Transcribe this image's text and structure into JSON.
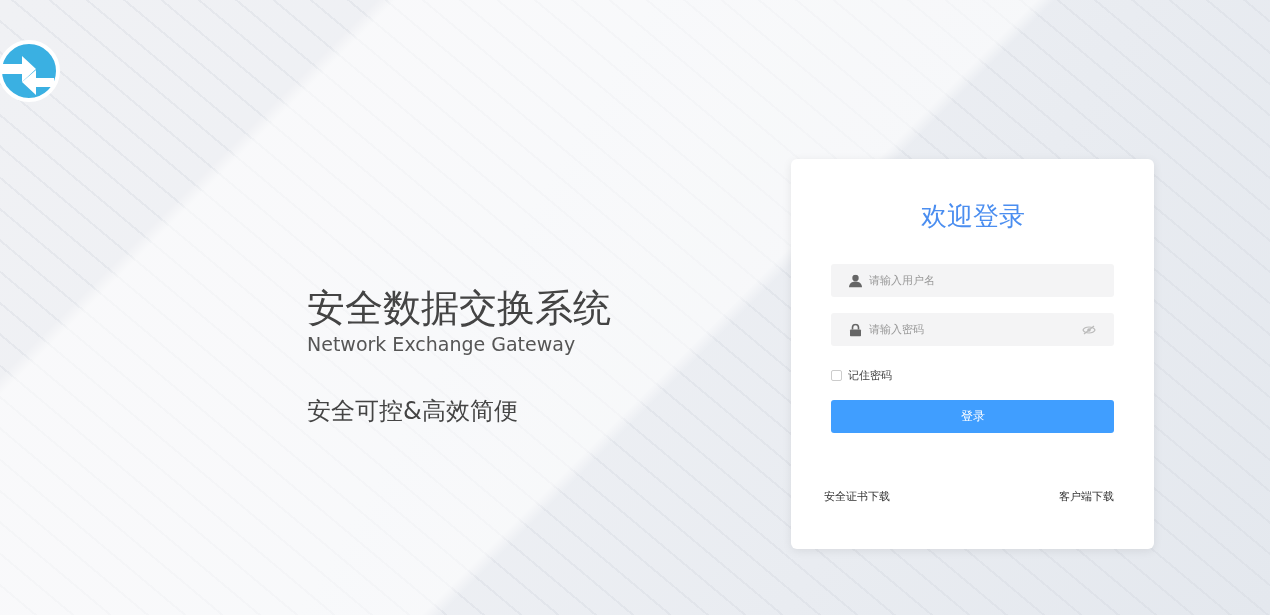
{
  "hero": {
    "title": "安全数据交换系统",
    "subtitle": "Network Exchange Gateway",
    "slogan": "安全可控&高效简便"
  },
  "login": {
    "heading": "欢迎登录",
    "username": {
      "placeholder": "请输入用户名"
    },
    "password": {
      "placeholder": "请输入密码"
    },
    "remember": {
      "label": "记住密码",
      "checked": false
    },
    "submit": "登录",
    "links": [
      "安全证书下载",
      "客户端下载"
    ]
  }
}
